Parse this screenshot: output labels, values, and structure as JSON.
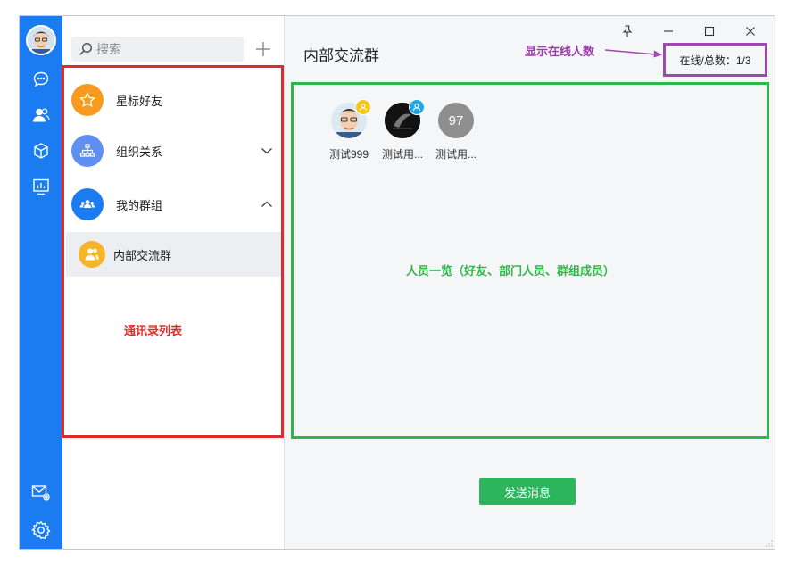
{
  "window": {
    "pin_icon": "pin-icon",
    "minimize_icon": "minimize-icon",
    "maximize_icon": "maximize-icon",
    "close_icon": "close-icon"
  },
  "rail": {
    "items": [
      {
        "name": "chat",
        "icon": "chat-bubble-icon"
      },
      {
        "name": "contacts",
        "icon": "contacts-icon"
      },
      {
        "name": "apps",
        "icon": "cube-icon"
      },
      {
        "name": "reports",
        "icon": "chart-icon"
      }
    ],
    "bottom": [
      {
        "name": "mail-settings",
        "icon": "mail-gear-icon"
      },
      {
        "name": "settings",
        "icon": "gear-icon"
      }
    ]
  },
  "contacts": {
    "search_placeholder": "搜索",
    "groups": [
      {
        "label": "星标好友",
        "icon": "star-icon",
        "color": "#f79a1e"
      },
      {
        "label": "组织关系",
        "icon": "org-tree-icon",
        "color": "#5f8ff0",
        "expanded": false
      },
      {
        "label": "我的群组",
        "icon": "group-icon",
        "color": "#1a7cf0",
        "expanded": true
      }
    ],
    "subgroup": {
      "label": "内部交流群",
      "color": "#f7b428"
    }
  },
  "annotations": {
    "contacts_list": "通讯录列表",
    "online_count": "显示在线人数",
    "members": "人员一览（好友、部门人员、群组成员）"
  },
  "main": {
    "title": "内部交流群",
    "online_status": "在线/总数：1/3",
    "members": [
      {
        "name": "测试999",
        "badge_color": "#f5c518"
      },
      {
        "name": "测试用...",
        "badge_color": "#25a6e8"
      },
      {
        "name": "测试用...",
        "avatar_text": "97",
        "avatar_color": "#8e8e8e"
      }
    ],
    "send_button": "发送消息"
  },
  "colors": {
    "rail_blue": "#1a7cf0",
    "annot_red": "#e12a2a",
    "annot_purple": "#a048b0",
    "annot_green": "#2fb548",
    "send_green": "#2db55d"
  }
}
